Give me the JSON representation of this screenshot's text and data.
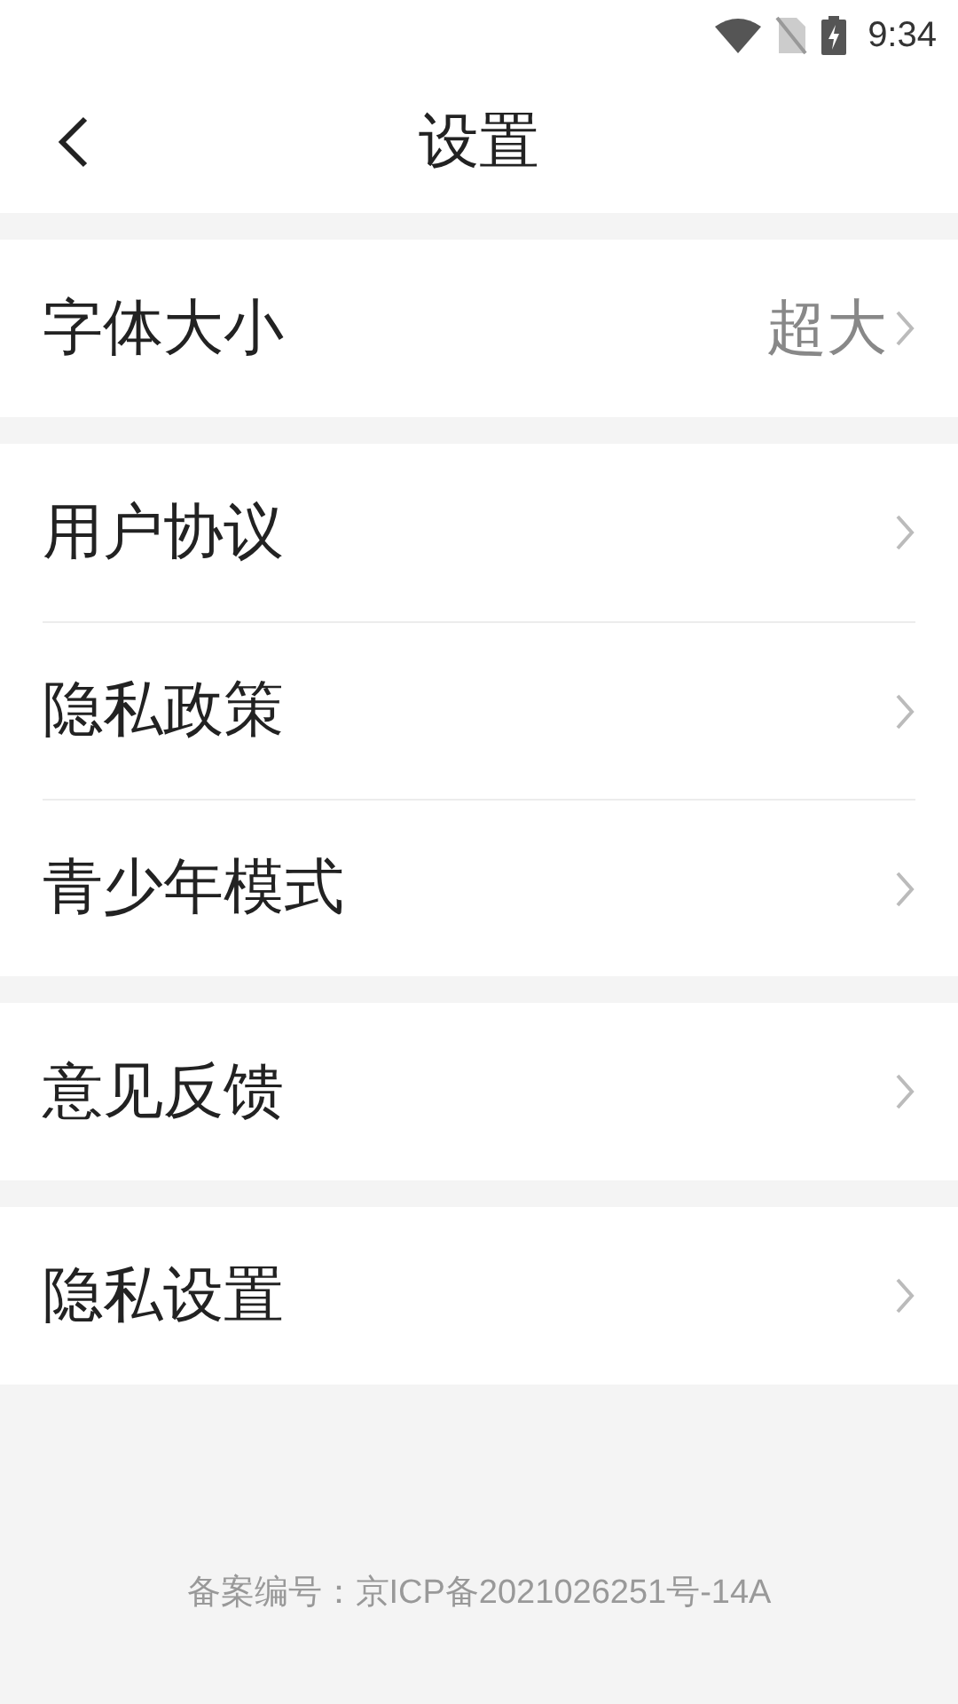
{
  "status_bar": {
    "time": "9:34"
  },
  "header": {
    "title": "设置"
  },
  "groups": [
    {
      "rows": [
        {
          "label": "字体大小",
          "value": "超大"
        }
      ]
    },
    {
      "rows": [
        {
          "label": "用户协议"
        },
        {
          "label": "隐私政策"
        },
        {
          "label": "青少年模式"
        }
      ]
    },
    {
      "rows": [
        {
          "label": "意见反馈"
        }
      ]
    },
    {
      "rows": [
        {
          "label": "隐私设置"
        }
      ]
    }
  ],
  "footer": "备案编号：京ICP备2021026251号-14A"
}
